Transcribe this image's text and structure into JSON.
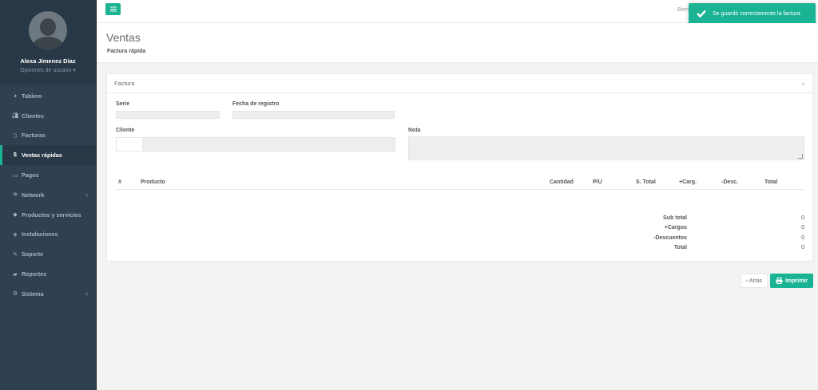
{
  "sidebar": {
    "user_name": "Alexa Jimenez Díaz",
    "user_options": "Opciones de usuario ▾",
    "items": [
      {
        "label": "Tablero",
        "icon": "dashboard-icon"
      },
      {
        "label": "Clientes",
        "icon": "users-icon"
      },
      {
        "label": "Facturas",
        "icon": "file-icon"
      },
      {
        "label": "Ventas rápidas",
        "icon": "dollar-icon"
      },
      {
        "label": "Pagos",
        "icon": "money-icon"
      },
      {
        "label": "Network",
        "icon": "network-icon"
      },
      {
        "label": "Productos y servicios",
        "icon": "tags-icon"
      },
      {
        "label": "Instalaciones",
        "icon": "tag-icon"
      },
      {
        "label": "Soporte",
        "icon": "wrench-icon"
      },
      {
        "label": "Reportes",
        "icon": "book-icon"
      },
      {
        "label": "Sistema",
        "icon": "cogs-icon"
      }
    ],
    "active_index": 3
  },
  "topbar": {
    "welcome_text": "Bien"
  },
  "toast": {
    "message": "Se guardó correctamente la factura"
  },
  "heading": {
    "title": "Ventas",
    "subtitle": "Factura rápida"
  },
  "card": {
    "title": "Factura",
    "close": "×",
    "serie_label": "Serie",
    "fecha_label": "Fecha de registro",
    "cliente_label": "Cliente",
    "nota_label": "Nota",
    "columns": [
      "#",
      "Producto",
      "Cantidad",
      "P/U",
      "S. Total",
      "+Carg.",
      "-Desc.",
      "Total"
    ],
    "totals": [
      {
        "label": "Sub total",
        "value": "0"
      },
      {
        "label": "+Cargos",
        "value": "0"
      },
      {
        "label": "-Descuentos",
        "value": "0"
      },
      {
        "label": "Total",
        "value": "0"
      }
    ]
  },
  "buttons": {
    "back": "‹ Atras",
    "print": "Imprimir"
  },
  "colors": {
    "accent": "#1ab394",
    "sidebar": "#2f4050"
  }
}
